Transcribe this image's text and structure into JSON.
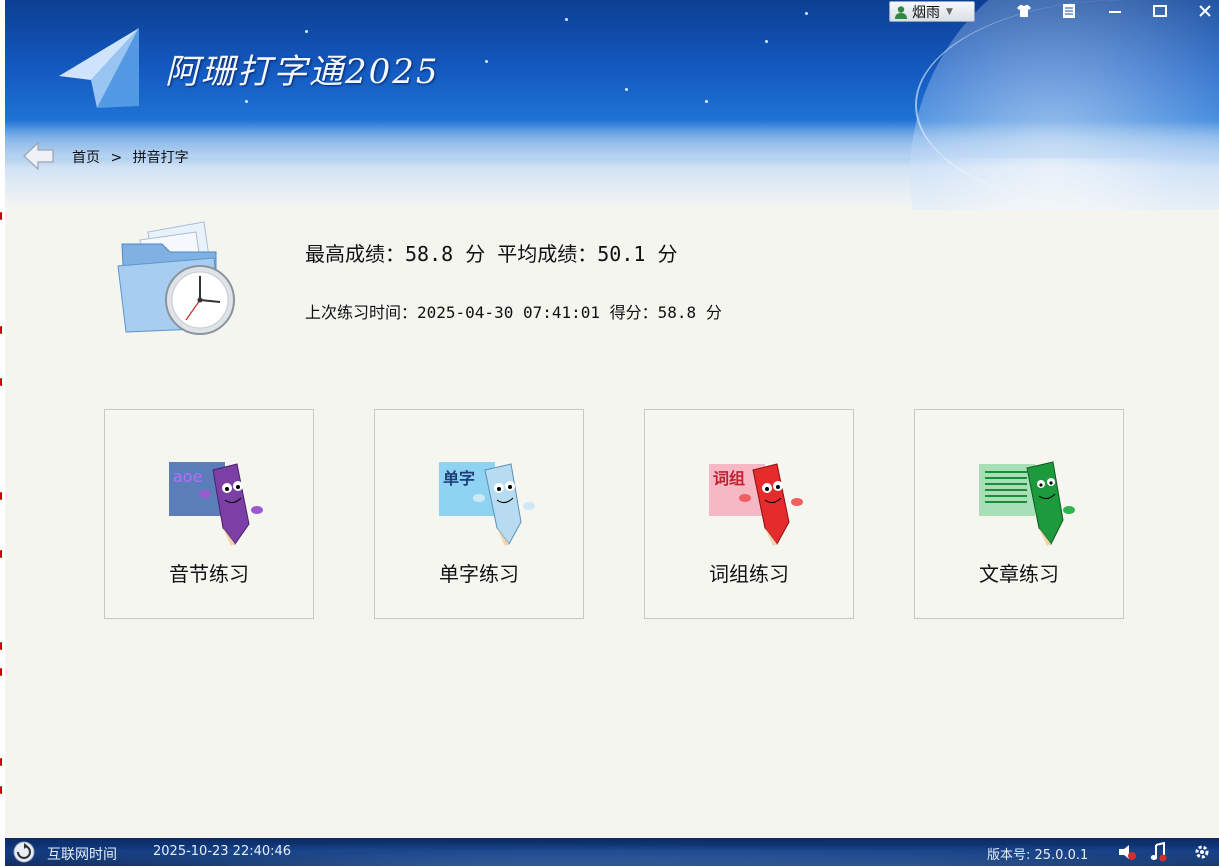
{
  "window": {
    "title": "阿珊打字通2025",
    "user_label": "烟雨",
    "controls": [
      "skin-icon",
      "notes-icon",
      "minimize-icon",
      "maximize-icon",
      "close-icon"
    ]
  },
  "breadcrumb": {
    "home": "首页",
    "separator": ">",
    "current": "拼音打字"
  },
  "stats": {
    "summary": "最高成绩：58.8 分 平均成绩：50.1 分",
    "last": "上次练习时间：2025-04-30 07:41:01 得分：58.8 分"
  },
  "cards": [
    {
      "label": "音节练习",
      "badge": "aoe",
      "color": "#7b3fa6",
      "board": "#5b7db8"
    },
    {
      "label": "单字练习",
      "badge": "单字",
      "color": "#8cc4e8",
      "board": "#8ed3f2"
    },
    {
      "label": "词组练习",
      "badge": "词组",
      "color": "#e52b2b",
      "board": "#f5b8c4"
    },
    {
      "label": "文章练习",
      "badge": "",
      "color": "#1d9a3c",
      "board": "#a7e0b6"
    }
  ],
  "status": {
    "time_label": "互联网时间",
    "time_value": "2025-10-23 22:40:46",
    "version": "版本号: 25.0.0.1"
  },
  "colors": {
    "header_dark": "#0c3f93",
    "content_bg": "#f5f5f0"
  }
}
